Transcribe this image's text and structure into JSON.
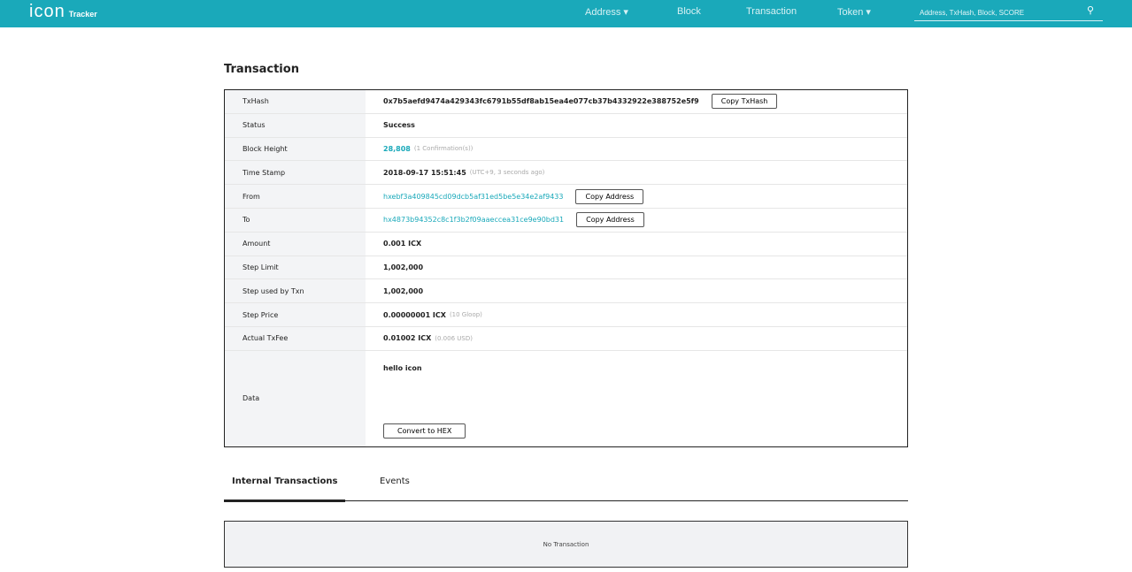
{
  "header": {
    "logo": "icon",
    "logo_sub": "Tracker",
    "nav": [
      "Address ▾",
      "Block",
      "Transaction",
      "Token ▾"
    ],
    "search_placeholder": "Address, TxHash, Block, SCORE"
  },
  "title": "Transaction",
  "rows": {
    "txhash": {
      "label": "TxHash",
      "value": "0x7b5aefd9474a429343fc6791b55df8ab15ea4e077cb37b4332922e388752e5f9",
      "button": "Copy TxHash"
    },
    "status": {
      "label": "Status",
      "value": "Success"
    },
    "block": {
      "label": "Block Height",
      "value": "28,808",
      "sub": "(1 Confirmation(s))"
    },
    "time": {
      "label": "Time Stamp",
      "value": "2018-09-17 15:51:45",
      "sub": "(UTC+9, 3 seconds ago)"
    },
    "from": {
      "label": "From",
      "value": "hxebf3a409845cd09dcb5af31ed5be5e34e2af9433",
      "button": "Copy Address"
    },
    "to": {
      "label": "To",
      "value": "hx4873b94352c8c1f3b2f09aaeccea31ce9e90bd31",
      "button": "Copy Address"
    },
    "amount": {
      "label": "Amount",
      "value": "0.001 ICX"
    },
    "step_limit": {
      "label": "Step Limit",
      "value": "1,002,000"
    },
    "step_used": {
      "label": "Step used by Txn",
      "value": "1,002,000"
    },
    "step_price": {
      "label": "Step Price",
      "value": "0.00000001 ICX",
      "sub": "(10 Gloop)"
    },
    "fee": {
      "label": "Actual TxFee",
      "value": "0.01002 ICX",
      "sub": "(0.006 USD)"
    },
    "data": {
      "label": "Data",
      "value": "hello icon",
      "button": "Convert to HEX"
    }
  },
  "tabs": [
    "Internal Transactions",
    "Events"
  ],
  "empty": "No Transaction"
}
